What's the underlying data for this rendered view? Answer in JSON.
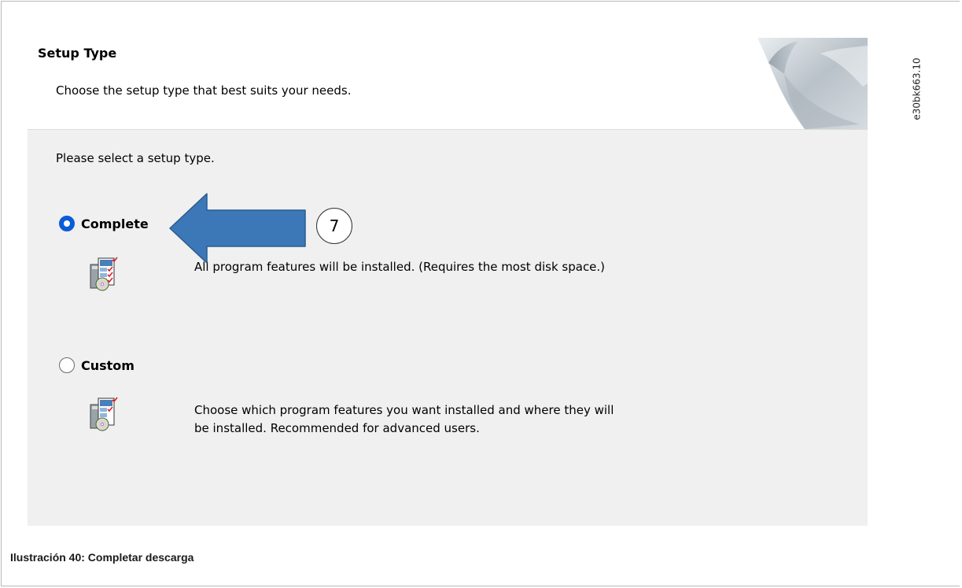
{
  "dialog": {
    "header": {
      "title": "Setup Type",
      "subtitle": "Choose the setup type that best suits your needs."
    },
    "prompt": "Please select a setup type.",
    "options": [
      {
        "label": "Complete",
        "selected": true,
        "description": "All program features will be installed. (Requires the most disk space.)",
        "icon": "setup-complete-icon"
      },
      {
        "label": "Custom",
        "selected": false,
        "description_lines": [
          "Choose which program features you want installed and where they will",
          "be installed. Recommended for advanced users."
        ],
        "icon": "setup-custom-icon"
      }
    ]
  },
  "figure": {
    "code": "e30bk663.10",
    "caption": "Ilustración 40: Completar descarga",
    "callout_number": "7"
  },
  "colors": {
    "radio_selected": "#0b5cd8",
    "callout_arrow": "#3c78b8",
    "dialog_background": "#f0f0f0",
    "header_background": "#ffffff"
  }
}
